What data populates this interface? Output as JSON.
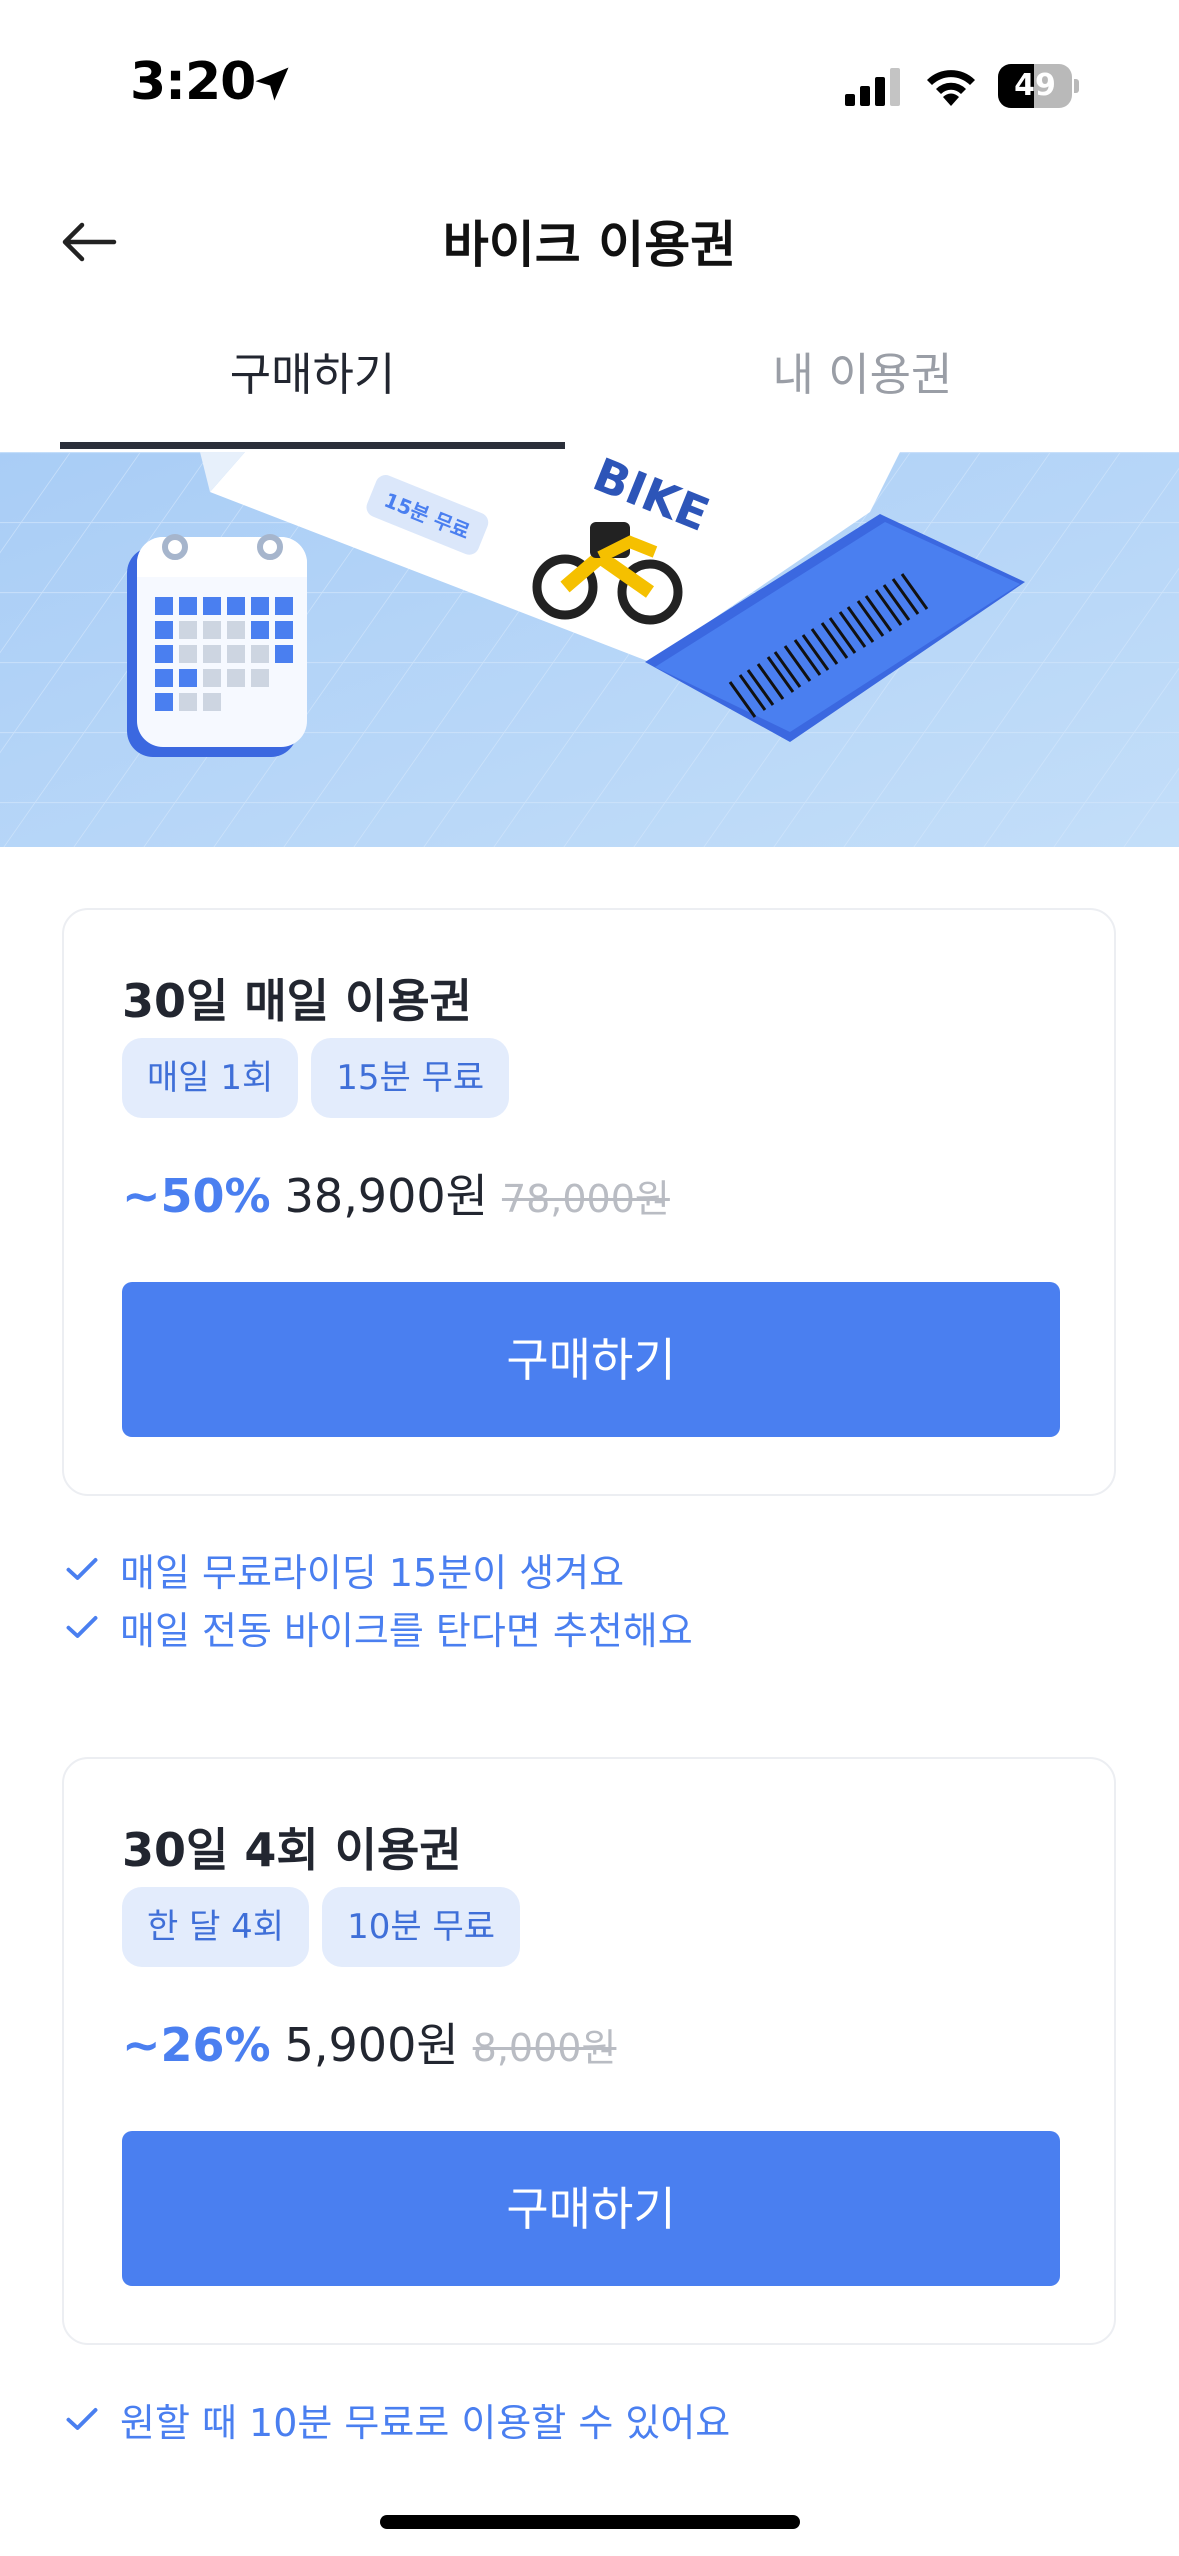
{
  "status_bar": {
    "time": "3:20",
    "battery": "49",
    "battery_level": 0.49
  },
  "header": {
    "title": "바이크 이용권",
    "back_icon": "arrow-left-icon"
  },
  "tabs": [
    {
      "label": "구매하기",
      "active": true
    },
    {
      "label": "내 이용권",
      "active": false
    }
  ],
  "banner": {
    "ticket_text": "BIKE",
    "ticket_chip": "15분 무료"
  },
  "passes": [
    {
      "title": "30일 매일 이용권",
      "badges": [
        "매일 1회",
        "15분 무료"
      ],
      "discount": "~50%",
      "price": "38,900원",
      "original_price": "78,000원",
      "button": "구매하기",
      "benefits": [
        "매일 무료라이딩 15분이 생겨요",
        "매일 전동 바이크를 탄다면 추천해요"
      ]
    },
    {
      "title": "30일 4회 이용권",
      "badges": [
        "한 달 4회",
        "10분 무료"
      ],
      "discount": "~26%",
      "price": "5,900원",
      "original_price": "8,000원",
      "button": "구매하기",
      "benefits": [
        "원할 때 10분 무료로 이용할 수 있어요"
      ]
    }
  ],
  "colors": {
    "accent": "#4a7ff0",
    "badge_bg": "#e3ecfc",
    "banner_bg": "#b6d6f7"
  }
}
